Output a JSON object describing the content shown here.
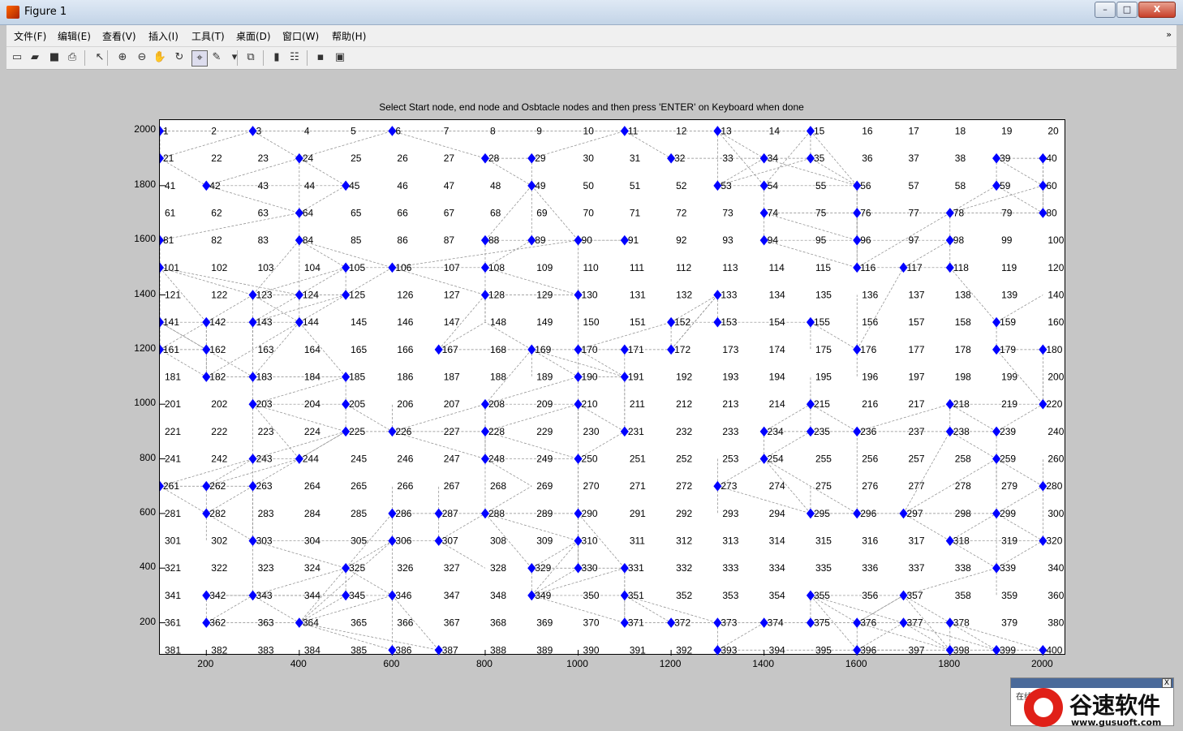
{
  "window": {
    "title": "Figure 1",
    "controls": {
      "minimize": "–",
      "maximize": "□",
      "close": "X"
    }
  },
  "menu": {
    "items": [
      "文件(F)",
      "编辑(E)",
      "查看(V)",
      "插入(I)",
      "工具(T)",
      "桌面(D)",
      "窗口(W)",
      "帮助(H)"
    ]
  },
  "toolbar": {
    "buttons": [
      {
        "name": "new-figure",
        "icon": "new-icon",
        "glyph": "▭"
      },
      {
        "name": "open-file",
        "icon": "folder-open-icon",
        "glyph": "▰"
      },
      {
        "name": "save-figure",
        "icon": "save-icon",
        "glyph": "■"
      },
      {
        "name": "print-figure",
        "icon": "print-icon",
        "glyph": "⎙"
      },
      {
        "name": "edit-plot",
        "icon": "pointer-arrow-icon",
        "glyph": "↖"
      },
      {
        "name": "zoom-in",
        "icon": "zoom-in-icon",
        "glyph": "⊕"
      },
      {
        "name": "zoom-out",
        "icon": "zoom-out-icon",
        "glyph": "⊖"
      },
      {
        "name": "pan",
        "icon": "hand-icon",
        "glyph": "✋"
      },
      {
        "name": "rotate-3d",
        "icon": "rotate-icon",
        "glyph": "↻"
      },
      {
        "name": "data-cursor",
        "icon": "data-cursor-icon",
        "glyph": "⌖"
      },
      {
        "name": "brush",
        "icon": "brush-icon",
        "glyph": "✎"
      },
      {
        "name": "brush-menu",
        "icon": "dropdown-arrow-icon",
        "glyph": "▾"
      },
      {
        "name": "link-plot",
        "icon": "link-icon",
        "glyph": "⧉"
      },
      {
        "name": "insert-colorbar",
        "icon": "colorbar-icon",
        "glyph": "▮"
      },
      {
        "name": "insert-legend",
        "icon": "legend-icon",
        "glyph": "☷"
      },
      {
        "name": "hide-plot-tools",
        "icon": "hide-tools-icon",
        "glyph": "▪"
      },
      {
        "name": "show-plot-tools",
        "icon": "show-tools-icon",
        "glyph": "▣"
      }
    ]
  },
  "plot": {
    "title": "Select Start node, end node and Osbtacle nodes and then press 'ENTER' on Keyboard when done"
  },
  "chart_data": {
    "type": "scatter",
    "title": "Select Start node, end node and Osbtacle nodes and then press 'ENTER' on Keyboard when done",
    "xlim": [
      100,
      2050
    ],
    "ylim": [
      80,
      2040
    ],
    "x_ticks": [
      200,
      400,
      600,
      800,
      1000,
      1200,
      1400,
      1600,
      1800,
      2000
    ],
    "y_ticks": [
      200,
      400,
      600,
      800,
      1000,
      1200,
      1400,
      1600,
      1800,
      2000
    ],
    "grid": {
      "columns": 20,
      "rows": 20,
      "spacing": 100,
      "x_start": 100,
      "y_top": 2000
    },
    "node_labels_count": 400,
    "marker_color": "#0000ff",
    "edge_color": "#888888",
    "obstacle_nodes": [
      1,
      3,
      6,
      11,
      13,
      15,
      21,
      24,
      28,
      29,
      32,
      34,
      35,
      39,
      40,
      42,
      45,
      49,
      53,
      54,
      56,
      59,
      60,
      64,
      74,
      76,
      78,
      80,
      81,
      84,
      88,
      89,
      90,
      91,
      94,
      96,
      98,
      101,
      105,
      106,
      108,
      116,
      117,
      118,
      123,
      124,
      125,
      128,
      130,
      133,
      141,
      142,
      143,
      144,
      152,
      153,
      155,
      159,
      161,
      162,
      167,
      169,
      170,
      171,
      172,
      176,
      179,
      180,
      182,
      183,
      185,
      190,
      191,
      203,
      205,
      208,
      210,
      215,
      218,
      220,
      225,
      226,
      228,
      231,
      234,
      235,
      236,
      238,
      239,
      243,
      244,
      248,
      250,
      254,
      259,
      261,
      262,
      263,
      273,
      280,
      282,
      286,
      287,
      288,
      290,
      295,
      296,
      297,
      299,
      303,
      306,
      307,
      310,
      318,
      320,
      325,
      329,
      330,
      331,
      339,
      342,
      343,
      345,
      346,
      349,
      351,
      355,
      357,
      362,
      364,
      371,
      372,
      373,
      374,
      375,
      376,
      377,
      378,
      386,
      387,
      393,
      396,
      398,
      399,
      400
    ],
    "edges": [
      [
        1,
        3
      ],
      [
        3,
        6
      ],
      [
        6,
        11
      ],
      [
        11,
        13
      ],
      [
        13,
        15
      ],
      [
        1,
        21
      ],
      [
        21,
        3
      ],
      [
        3,
        24
      ],
      [
        24,
        6
      ],
      [
        6,
        28
      ],
      [
        28,
        29
      ],
      [
        29,
        11
      ],
      [
        11,
        32
      ],
      [
        32,
        34
      ],
      [
        34,
        35
      ],
      [
        35,
        15
      ],
      [
        13,
        53
      ],
      [
        13,
        34
      ],
      [
        13,
        54
      ],
      [
        15,
        56
      ],
      [
        15,
        54
      ],
      [
        34,
        53
      ],
      [
        34,
        56
      ],
      [
        35,
        56
      ],
      [
        35,
        53
      ],
      [
        39,
        40
      ],
      [
        39,
        60
      ],
      [
        40,
        60
      ],
      [
        39,
        59
      ],
      [
        40,
        80
      ],
      [
        60,
        80
      ],
      [
        59,
        80
      ],
      [
        59,
        78
      ],
      [
        80,
        78
      ],
      [
        60,
        78
      ],
      [
        78,
        98
      ],
      [
        78,
        116
      ],
      [
        78,
        76
      ],
      [
        76,
        56
      ],
      [
        76,
        74
      ],
      [
        74,
        54
      ],
      [
        54,
        56
      ],
      [
        54,
        53
      ],
      [
        74,
        94
      ],
      [
        94,
        116
      ],
      [
        94,
        96
      ],
      [
        96,
        98
      ],
      [
        96,
        76
      ],
      [
        98,
        117
      ],
      [
        116,
        117
      ],
      [
        117,
        118
      ],
      [
        118,
        98
      ],
      [
        56,
        96
      ],
      [
        56,
        116
      ],
      [
        74,
        96
      ],
      [
        76,
        116
      ],
      [
        42,
        45
      ],
      [
        21,
        42
      ],
      [
        42,
        64
      ],
      [
        64,
        84
      ],
      [
        45,
        64
      ],
      [
        45,
        24
      ],
      [
        24,
        64
      ],
      [
        24,
        42
      ],
      [
        29,
        49
      ],
      [
        49,
        89
      ],
      [
        49,
        90
      ],
      [
        49,
        88
      ],
      [
        28,
        49
      ],
      [
        88,
        89
      ],
      [
        89,
        90
      ],
      [
        90,
        91
      ],
      [
        91,
        90
      ],
      [
        81,
        101
      ],
      [
        81,
        64
      ],
      [
        84,
        105
      ],
      [
        84,
        106
      ],
      [
        84,
        124
      ],
      [
        84,
        123
      ],
      [
        101,
        123
      ],
      [
        101,
        141
      ],
      [
        101,
        124
      ],
      [
        101,
        142
      ],
      [
        105,
        106
      ],
      [
        105,
        125
      ],
      [
        105,
        124
      ],
      [
        105,
        123
      ],
      [
        106,
        125
      ],
      [
        106,
        108
      ],
      [
        106,
        90
      ],
      [
        106,
        128
      ],
      [
        108,
        128
      ],
      [
        108,
        88
      ],
      [
        108,
        89
      ],
      [
        108,
        130
      ],
      [
        128,
        130
      ],
      [
        128,
        148
      ],
      [
        130,
        170
      ],
      [
        130,
        150
      ],
      [
        130,
        90
      ],
      [
        123,
        124
      ],
      [
        123,
        143
      ],
      [
        123,
        142
      ],
      [
        123,
        144
      ],
      [
        124,
        125
      ],
      [
        124,
        144
      ],
      [
        124,
        143
      ],
      [
        125,
        143
      ],
      [
        125,
        144
      ],
      [
        141,
        142
      ],
      [
        142,
        143
      ],
      [
        143,
        144
      ],
      [
        141,
        161
      ],
      [
        141,
        162
      ],
      [
        142,
        161
      ],
      [
        142,
        162
      ],
      [
        142,
        182
      ],
      [
        143,
        183
      ],
      [
        143,
        163
      ],
      [
        144,
        183
      ],
      [
        144,
        182
      ],
      [
        161,
        162
      ],
      [
        161,
        141
      ],
      [
        161,
        182
      ],
      [
        162,
        182
      ],
      [
        162,
        183
      ],
      [
        162,
        141
      ],
      [
        182,
        183
      ],
      [
        183,
        185
      ],
      [
        183,
        203
      ],
      [
        185,
        203
      ],
      [
        185,
        205
      ],
      [
        185,
        144
      ],
      [
        203,
        205
      ],
      [
        205,
        225
      ],
      [
        205,
        226
      ],
      [
        203,
        243
      ],
      [
        203,
        244
      ],
      [
        203,
        225
      ],
      [
        225,
        226
      ],
      [
        225,
        244
      ],
      [
        225,
        243
      ],
      [
        226,
        228
      ],
      [
        226,
        248
      ],
      [
        226,
        208
      ],
      [
        226,
        206
      ],
      [
        208,
        228
      ],
      [
        208,
        210
      ],
      [
        208,
        248
      ],
      [
        208,
        190
      ],
      [
        210,
        190
      ],
      [
        210,
        230
      ],
      [
        210,
        228
      ],
      [
        210,
        250
      ],
      [
        228,
        248
      ],
      [
        228,
        250
      ],
      [
        248,
        250
      ],
      [
        248,
        288
      ],
      [
        248,
        269
      ],
      [
        250,
        290
      ],
      [
        250,
        231
      ],
      [
        231,
        210
      ],
      [
        231,
        191
      ],
      [
        231,
        211
      ],
      [
        190,
        191
      ],
      [
        190,
        170
      ],
      [
        191,
        171
      ],
      [
        191,
        170
      ],
      [
        191,
        211
      ],
      [
        169,
        170
      ],
      [
        169,
        190
      ],
      [
        169,
        191
      ],
      [
        169,
        148
      ],
      [
        170,
        171
      ],
      [
        171,
        172
      ],
      [
        170,
        152
      ],
      [
        152,
        153
      ],
      [
        153,
        133
      ],
      [
        133,
        152
      ],
      [
        133,
        172
      ],
      [
        153,
        155
      ],
      [
        155,
        175
      ],
      [
        172,
        152
      ],
      [
        167,
        128
      ],
      [
        167,
        148
      ],
      [
        167,
        169
      ],
      [
        169,
        189
      ],
      [
        169,
        208
      ],
      [
        243,
        244
      ],
      [
        243,
        261
      ],
      [
        243,
        262
      ],
      [
        243,
        263
      ],
      [
        244,
        262
      ],
      [
        244,
        263
      ],
      [
        244,
        225
      ],
      [
        261,
        262
      ],
      [
        262,
        263
      ],
      [
        262,
        282
      ],
      [
        261,
        282
      ],
      [
        263,
        282
      ],
      [
        263,
        283
      ],
      [
        263,
        303
      ],
      [
        282,
        303
      ],
      [
        282,
        302
      ],
      [
        303,
        325
      ],
      [
        303,
        343
      ],
      [
        303,
        306
      ],
      [
        325,
        345
      ],
      [
        325,
        343
      ],
      [
        325,
        306
      ],
      [
        325,
        286
      ],
      [
        325,
        346
      ],
      [
        345,
        346
      ],
      [
        345,
        364
      ],
      [
        345,
        342
      ],
      [
        345,
        343
      ],
      [
        342,
        343
      ],
      [
        342,
        362
      ],
      [
        362,
        343
      ],
      [
        362,
        364
      ],
      [
        343,
        364
      ],
      [
        364,
        346
      ],
      [
        364,
        386
      ],
      [
        364,
        387
      ],
      [
        364,
        325
      ],
      [
        364,
        306
      ],
      [
        346,
        386
      ],
      [
        346,
        387
      ],
      [
        346,
        306
      ],
      [
        306,
        307
      ],
      [
        306,
        286
      ],
      [
        307,
        287
      ],
      [
        307,
        288
      ],
      [
        307,
        328
      ],
      [
        286,
        287
      ],
      [
        287,
        288
      ],
      [
        288,
        290
      ],
      [
        288,
        269
      ],
      [
        288,
        310
      ],
      [
        288,
        329
      ],
      [
        290,
        310
      ],
      [
        290,
        330
      ],
      [
        290,
        331
      ],
      [
        310,
        330
      ],
      [
        310,
        329
      ],
      [
        310,
        349
      ],
      [
        329,
        330
      ],
      [
        330,
        331
      ],
      [
        329,
        349
      ],
      [
        330,
        349
      ],
      [
        331,
        351
      ],
      [
        331,
        349
      ],
      [
        331,
        371
      ],
      [
        349,
        351
      ],
      [
        349,
        371
      ],
      [
        351,
        371
      ],
      [
        351,
        372
      ],
      [
        351,
        373
      ],
      [
        371,
        372
      ],
      [
        372,
        373
      ],
      [
        373,
        374
      ],
      [
        374,
        375
      ],
      [
        375,
        376
      ],
      [
        376,
        377
      ],
      [
        377,
        378
      ],
      [
        378,
        398
      ],
      [
        398,
        399
      ],
      [
        399,
        400
      ],
      [
        373,
        393
      ],
      [
        374,
        393
      ],
      [
        393,
        396
      ],
      [
        375,
        355
      ],
      [
        355,
        376
      ],
      [
        355,
        357
      ],
      [
        355,
        377
      ],
      [
        355,
        396
      ],
      [
        357,
        376
      ],
      [
        357,
        378
      ],
      [
        357,
        398
      ],
      [
        357,
        339
      ],
      [
        376,
        396
      ],
      [
        376,
        398
      ],
      [
        376,
        357
      ],
      [
        377,
        396
      ],
      [
        377,
        398
      ],
      [
        377,
        399
      ],
      [
        378,
        399
      ],
      [
        378,
        400
      ],
      [
        396,
        398
      ],
      [
        396,
        397
      ],
      [
        339,
        359
      ],
      [
        339,
        320
      ],
      [
        339,
        318
      ],
      [
        339,
        299
      ],
      [
        318,
        320
      ],
      [
        318,
        299
      ],
      [
        318,
        297
      ],
      [
        299,
        297
      ],
      [
        297,
        296
      ],
      [
        296,
        295
      ],
      [
        295,
        275
      ],
      [
        295,
        254
      ],
      [
        296,
        254
      ],
      [
        296,
        236
      ],
      [
        297,
        259
      ],
      [
        297,
        238
      ],
      [
        299,
        259
      ],
      [
        299,
        320
      ],
      [
        299,
        280
      ],
      [
        280,
        259
      ],
      [
        280,
        260
      ],
      [
        280,
        320
      ],
      [
        259,
        239
      ],
      [
        259,
        238
      ],
      [
        259,
        279
      ],
      [
        239,
        238
      ],
      [
        239,
        220
      ],
      [
        239,
        218
      ],
      [
        238,
        236
      ],
      [
        238,
        218
      ],
      [
        236,
        235
      ],
      [
        236,
        215
      ],
      [
        236,
        218
      ],
      [
        235,
        234
      ],
      [
        235,
        215
      ],
      [
        234,
        215
      ],
      [
        234,
        254
      ],
      [
        254,
        235
      ],
      [
        254,
        273
      ],
      [
        273,
        295
      ],
      [
        218,
        220
      ],
      [
        220,
        180
      ],
      [
        180,
        179
      ],
      [
        179,
        159
      ],
      [
        179,
        220
      ],
      [
        159,
        140
      ],
      [
        159,
        118
      ],
      [
        176,
        155
      ],
      [
        176,
        196
      ],
      [
        176,
        136
      ],
      [
        176,
        117
      ],
      [
        215,
        195
      ],
      [
        220,
        200
      ],
      [
        250,
        270
      ],
      [
        290,
        270
      ],
      [
        210,
        230
      ],
      [
        253,
        273
      ],
      [
        273,
        293
      ],
      [
        287,
        267
      ],
      [
        286,
        266
      ],
      [
        303,
        283
      ],
      [
        128,
        148
      ],
      [
        172,
        133
      ]
    ]
  },
  "dialog": {
    "close": "X",
    "text": "在线…"
  },
  "watermark": {
    "brand_cn": "谷速软件",
    "url": "www.gusuoft.com"
  }
}
